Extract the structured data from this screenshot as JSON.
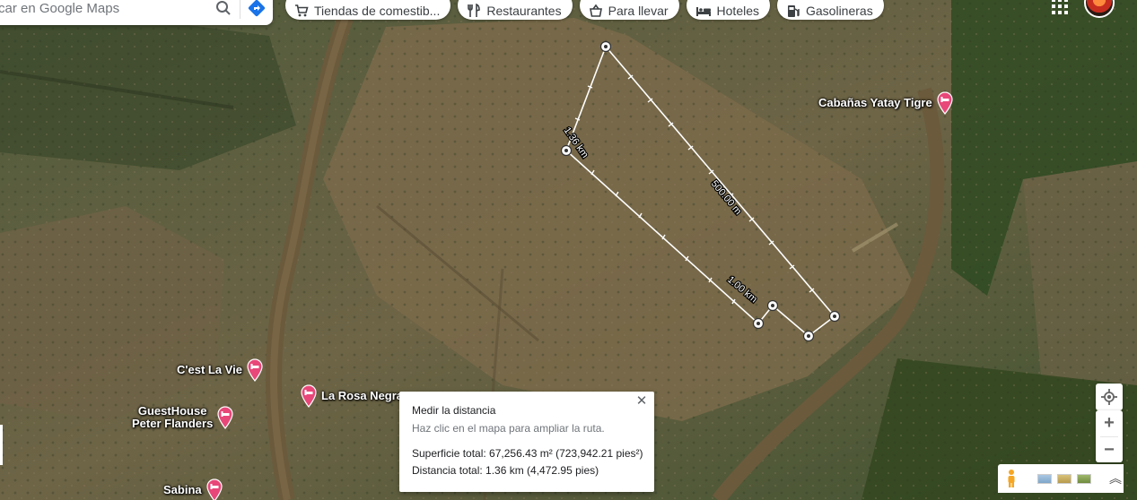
{
  "search": {
    "placeholder": "car en Google Maps"
  },
  "chips": [
    {
      "icon": "cart-icon",
      "label": "Tiendas de comestib..."
    },
    {
      "icon": "utensils-icon",
      "label": "Restaurantes"
    },
    {
      "icon": "takeout-icon",
      "label": "Para llevar"
    },
    {
      "icon": "bed-icon",
      "label": "Hoteles"
    },
    {
      "icon": "gas-pump-icon",
      "label": "Gasolineras"
    }
  ],
  "pois": [
    {
      "name": "Cabañas Yatay Tigre",
      "icon": "hotel-pin-icon"
    },
    {
      "name": "C'est La Vie",
      "icon": "hotel-pin-icon"
    },
    {
      "name": "GuestHouse",
      "name2": "Peter Flanders",
      "icon": "hotel-pin-icon"
    },
    {
      "name": "La Rosa Negra",
      "icon": "hotel-pin-icon"
    },
    {
      "name": "Sabina",
      "icon": "hotel-pin-icon"
    }
  ],
  "measure": {
    "labels": [
      "1.36 km",
      "500.00 m",
      "1.00 km"
    ],
    "card": {
      "title": "Medir la distancia",
      "hint": "Haz clic en el mapa para ampliar la ruta.",
      "area": "Superficie total: 67,256.43 m² (723,942.21 pies²)",
      "distance": "Distancia total: 1.36 km (4,472.95 pies)",
      "close": "✕"
    }
  },
  "controls": {
    "zoom_in": "+",
    "zoom_out": "−",
    "layers_chevron": "︽"
  },
  "colors": {
    "route": "#ffffff",
    "poi_pin": "#e8477a",
    "river": "#6b5a3c"
  }
}
